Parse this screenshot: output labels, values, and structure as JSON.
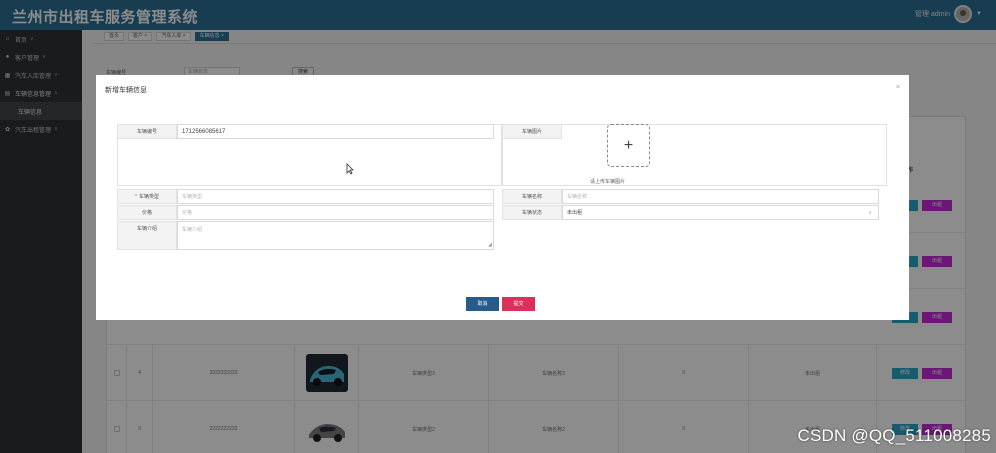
{
  "header": {
    "title": "兰州市出租车服务管理系统",
    "menu_icon": "hamburger-icon",
    "user_label": "管理 admin"
  },
  "sidebar": {
    "items": [
      {
        "label": "首页",
        "icon": "home-icon"
      },
      {
        "label": "客户管理",
        "icon": "user-icon"
      },
      {
        "label": "汽车入库管理",
        "icon": "grid-icon"
      },
      {
        "label": "车辆信息管理",
        "icon": "list-icon"
      },
      {
        "label": "车辆信息",
        "icon": ""
      },
      {
        "label": "汽车出租管理",
        "icon": "gear-icon"
      }
    ]
  },
  "tabs": [
    {
      "label": "首页"
    },
    {
      "label": "客户 ×"
    },
    {
      "label": "汽车入库 ×"
    },
    {
      "label": "车辆信息 ×"
    }
  ],
  "search": {
    "label": "车辆编号",
    "placeholder": "车辆状态",
    "button": "搜索"
  },
  "table": {
    "op_header": "操作",
    "edit_label": "修改",
    "delete_label": "出租",
    "rows": [
      {
        "idx": "4",
        "code": "3333333333",
        "type": "车辆类型3",
        "name": "车辆名称3",
        "price": "3",
        "status": "未出租"
      },
      {
        "idx": "3",
        "code": "2222222222",
        "type": "车辆类型2",
        "name": "车辆名称2",
        "price": "3",
        "status": "未出租"
      }
    ]
  },
  "modal": {
    "title": "新增车辆信息",
    "fields": {
      "vehicle_no_label": "车辆编号",
      "vehicle_no_value": "1712566085617",
      "vehicle_image_label": "车辆图片",
      "upload_tip": "请上传车辆图片",
      "vehicle_type_label": "车辆类型",
      "vehicle_type_placeholder": "车辆类型",
      "vehicle_name_label": "车辆名称",
      "vehicle_name_placeholder": "车辆名称",
      "price_label": "价格",
      "price_placeholder": "价格",
      "status_label": "车辆状态",
      "status_value": "未出租",
      "desc_label": "车辆介绍",
      "desc_placeholder": "车辆介绍"
    },
    "cancel": "取消",
    "submit": "提交"
  },
  "watermark": "CSDN @QQ_511008285",
  "colors": {
    "header": "#2f6f93",
    "sidebar": "#2e3338",
    "cancel": "#275b89",
    "submit": "#d9315c",
    "edit": "#2aa7c9",
    "delete": "#c22ad6"
  }
}
